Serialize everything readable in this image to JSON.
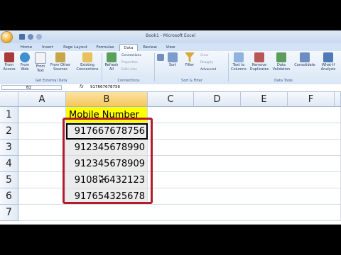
{
  "window": {
    "title": "Book1 - Microsoft Excel"
  },
  "tabs": [
    "Home",
    "Insert",
    "Page Layout",
    "Formulas",
    "Data",
    "Review",
    "View"
  ],
  "active_tab": "Data",
  "ribbon": {
    "from_access": "From Access",
    "from_web": "From Web",
    "from_text": "From Text",
    "from_other": "From Other Sources",
    "existing": "Existing Connections",
    "refresh": "Refresh All",
    "connections": "Connections",
    "properties": "Properties",
    "edit_links": "Edit Links",
    "sort": "Sort",
    "filter": "Filter",
    "clear": "Clear",
    "reapply": "Reapply",
    "advanced": "Advanced",
    "text_to_columns": "Text to Columns",
    "remove_duplicates": "Remove Duplicates",
    "data_validation": "Data Validation",
    "consolidate": "Consolidate",
    "what_if": "What-If Analysis",
    "groups": {
      "external": "Get External Data",
      "connections": "Connections",
      "sort_filter": "Sort & Filter",
      "data_tools": "Data Tools"
    }
  },
  "formula_bar": {
    "name_box": "B2",
    "fx": "fx",
    "value": "917667678756"
  },
  "columns": [
    "A",
    "B",
    "C",
    "D",
    "E",
    "F"
  ],
  "rows": [
    "1",
    "2",
    "3",
    "4",
    "5",
    "6",
    "7"
  ],
  "header_cell": "Mobile Number",
  "numbers": [
    "917667678756",
    "912345678990",
    "912345678909",
    "910876432123",
    "917654325678"
  ],
  "colors": {
    "highlight": "#ffff00",
    "annotation": "#b01c2c",
    "ribbon": "#dbe7f6"
  }
}
